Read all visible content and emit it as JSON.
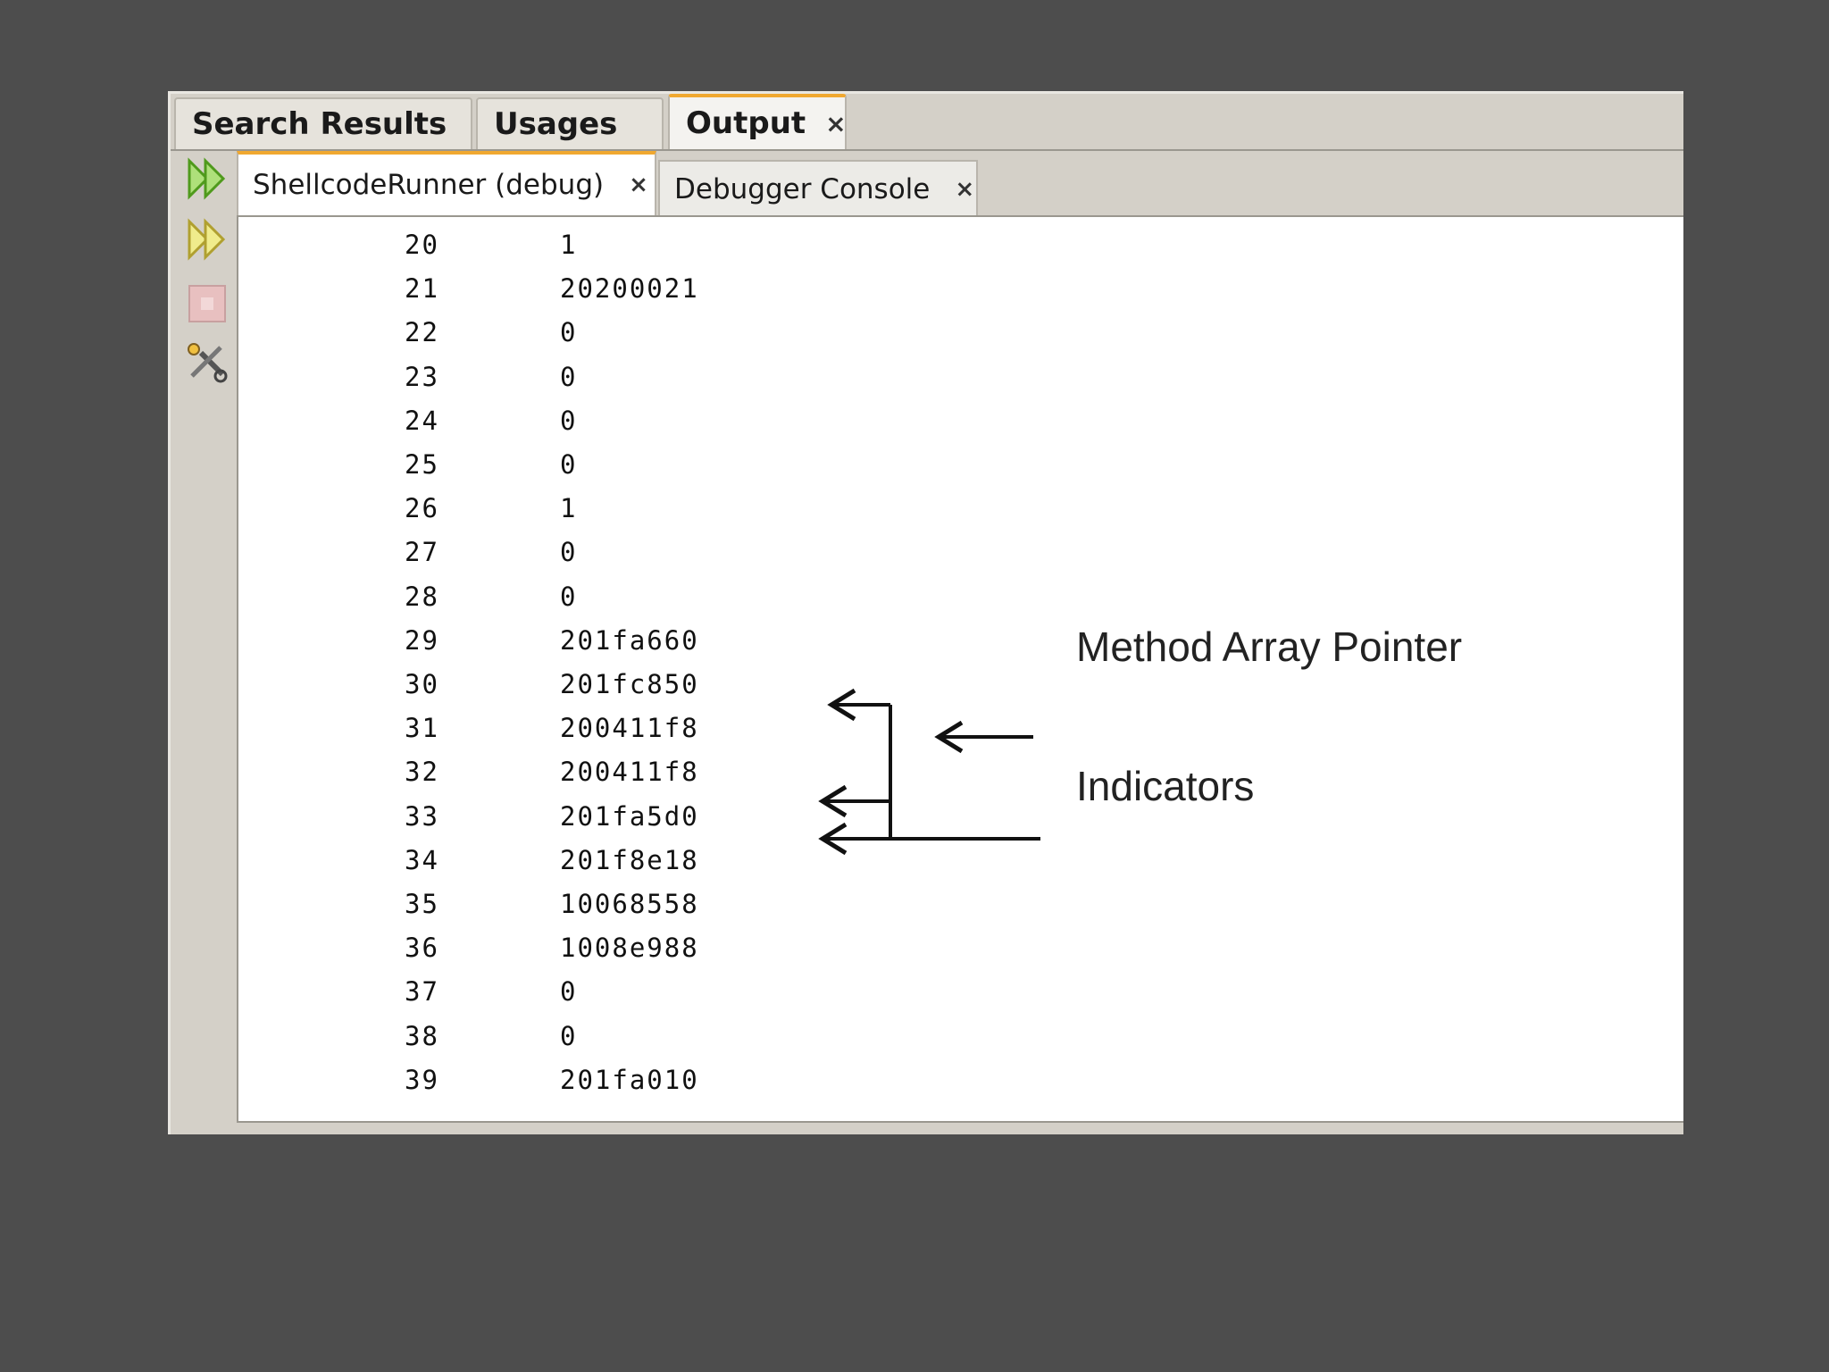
{
  "top_tabs": [
    {
      "label": "Search Results"
    },
    {
      "label": "Usages"
    },
    {
      "label": "Output",
      "close": "×",
      "active": true
    }
  ],
  "sub_tabs": [
    {
      "label": "ShellcodeRunner (debug)",
      "close": "×",
      "active": true
    },
    {
      "label": "Debugger Console",
      "close": "×"
    }
  ],
  "toolbar": {
    "icons": [
      "rerun-icon",
      "rerun-with-options-icon",
      "stop-icon",
      "settings-icon"
    ]
  },
  "output_rows": [
    {
      "num": "20",
      "val": "1"
    },
    {
      "num": "21",
      "val": "20200021"
    },
    {
      "num": "22",
      "val": "0"
    },
    {
      "num": "23",
      "val": "0"
    },
    {
      "num": "24",
      "val": "0"
    },
    {
      "num": "25",
      "val": "0"
    },
    {
      "num": "26",
      "val": "1"
    },
    {
      "num": "27",
      "val": "0"
    },
    {
      "num": "28",
      "val": "0"
    },
    {
      "num": "29",
      "val": "201fa660"
    },
    {
      "num": "30",
      "val": "201fc850"
    },
    {
      "num": "31",
      "val": "200411f8"
    },
    {
      "num": "32",
      "val": "200411f8"
    },
    {
      "num": "33",
      "val": "201fa5d0"
    },
    {
      "num": "34",
      "val": "201f8e18"
    },
    {
      "num": "35",
      "val": "10068558"
    },
    {
      "num": "36",
      "val": "1008e988"
    },
    {
      "num": "37",
      "val": "0"
    },
    {
      "num": "38",
      "val": "0"
    },
    {
      "num": "39",
      "val": "201fa010"
    }
  ],
  "annotations": {
    "method_array_pointer": "Method Array Pointer",
    "indicators": "Indicators"
  },
  "colors": {
    "background": "#4d4d4d",
    "active_tab_accent": "#f0a830",
    "run_icon": "#7fc63a",
    "rerun_icon": "#d8d040"
  }
}
